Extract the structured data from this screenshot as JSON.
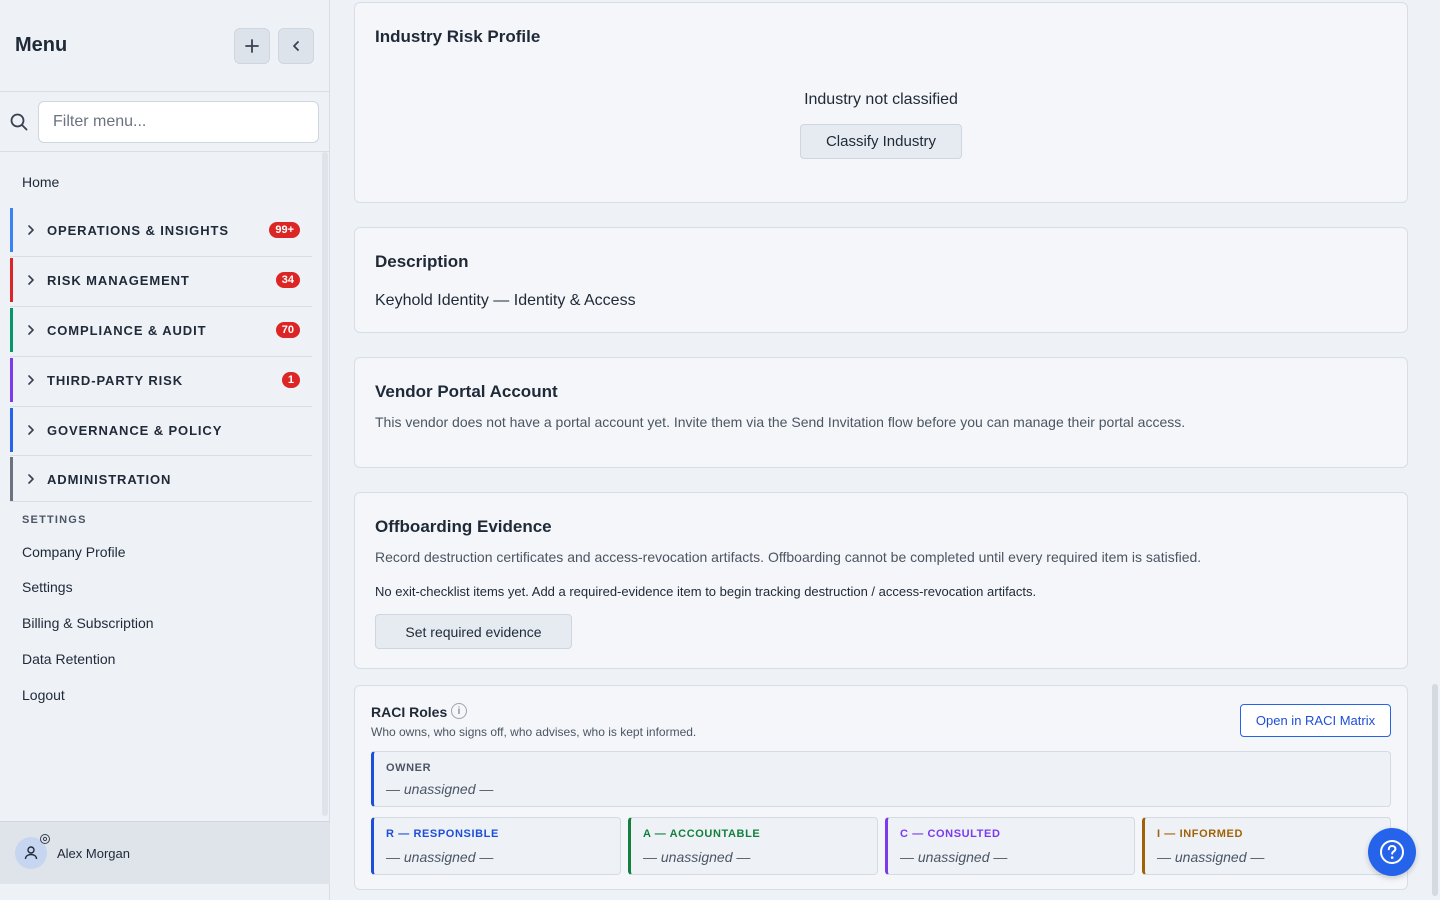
{
  "sidebar": {
    "title": "Menu",
    "filter_placeholder": "Filter menu...",
    "home": "Home",
    "groups": [
      {
        "label": "OPERATIONS & INSIGHTS",
        "badge": "99+",
        "color": "#3b82f6"
      },
      {
        "label": "RISK MANAGEMENT",
        "badge": "34",
        "color": "#dc2626"
      },
      {
        "label": "COMPLIANCE & AUDIT",
        "badge": "70",
        "color": "#059669"
      },
      {
        "label": "THIRD-PARTY RISK",
        "badge": "1",
        "color": "#7c3aed"
      },
      {
        "label": "GOVERNANCE & POLICY",
        "badge": "",
        "color": "#2563eb"
      },
      {
        "label": "ADMINISTRATION",
        "badge": "",
        "color": "#6b7280"
      }
    ],
    "settings_section": "SETTINGS",
    "settings_links": [
      "Company Profile",
      "Settings",
      "Billing & Subscription",
      "Data Retention",
      "Logout"
    ],
    "user_name": "Alex Morgan"
  },
  "industry": {
    "title": "Industry Risk Profile",
    "status": "Industry not classified",
    "button": "Classify Industry"
  },
  "description": {
    "title": "Description",
    "text": "Keyhold Identity — Identity & Access"
  },
  "portal": {
    "title": "Vendor Portal Account",
    "text": "This vendor does not have a portal account yet. Invite them via the Send Invitation flow before you can manage their portal access."
  },
  "offboarding": {
    "title": "Offboarding Evidence",
    "subtitle": "Record destruction certificates and access-revocation artifacts. Offboarding cannot be completed until every required item is satisfied.",
    "empty": "No exit-checklist items yet. Add a required-evidence item to begin tracking destruction / access-revocation artifacts.",
    "button": "Set required evidence"
  },
  "raci": {
    "title": "RACI Roles",
    "info_icon": "i",
    "subtitle": "Who owns, who signs off, who advises, who is kept informed.",
    "open_button": "Open in RACI Matrix",
    "owner_label": "OWNER",
    "owner_value": "— unassigned —",
    "roles": [
      {
        "label": "R — RESPONSIBLE",
        "value": "— unassigned —",
        "color": "#1d4ed8"
      },
      {
        "label": "A — ACCOUNTABLE",
        "value": "— unassigned —",
        "color": "#15803d"
      },
      {
        "label": "C — CONSULTED",
        "value": "— unassigned —",
        "color": "#7c3aed"
      },
      {
        "label": "I — INFORMED",
        "value": "— unassigned —",
        "color": "#a16207"
      }
    ]
  }
}
